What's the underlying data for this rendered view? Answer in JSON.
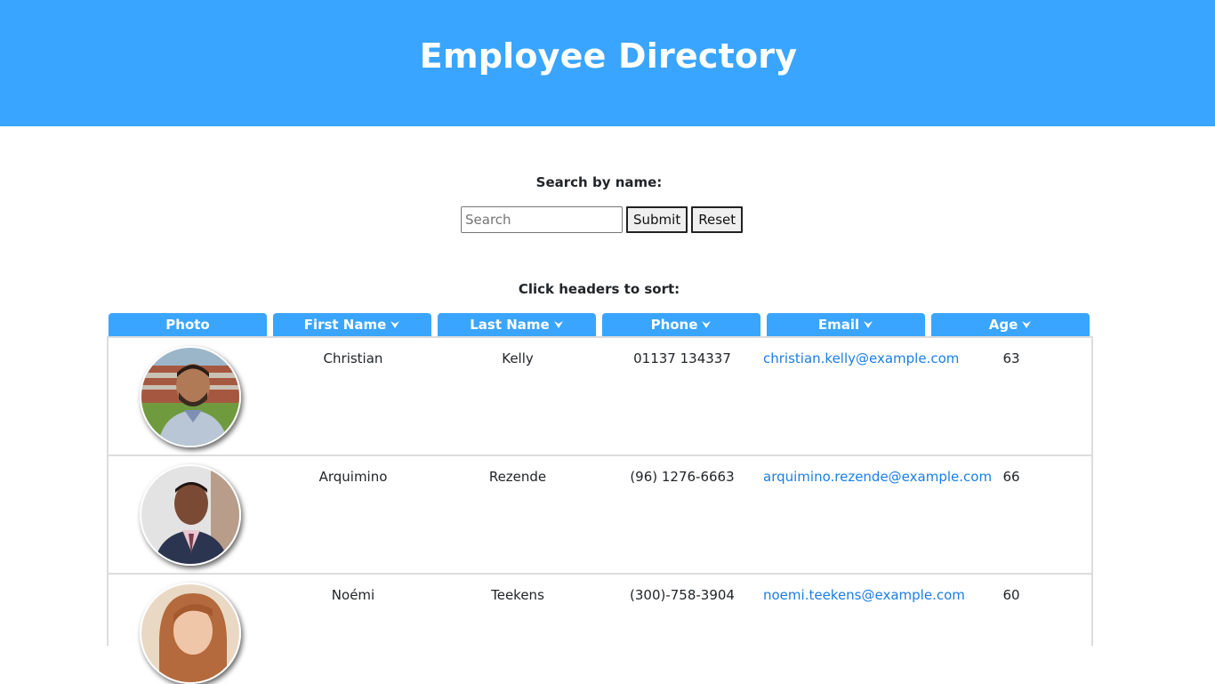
{
  "header": {
    "title": "Employee Directory"
  },
  "search": {
    "label": "Search by name:",
    "placeholder": "Search",
    "value": "",
    "submit_label": "Submit",
    "reset_label": "Reset"
  },
  "sort": {
    "label": "Click headers to sort:"
  },
  "colors": {
    "accent": "#3aa5ff",
    "link": "#1a7ee6",
    "border": "#dcdcdc"
  },
  "columns": [
    {
      "label": "Photo",
      "sortable": false
    },
    {
      "label": "First Name",
      "sortable": true
    },
    {
      "label": "Last Name",
      "sortable": true
    },
    {
      "label": "Phone",
      "sortable": true
    },
    {
      "label": "Email",
      "sortable": true
    },
    {
      "label": "Age",
      "sortable": true
    }
  ],
  "employees": [
    {
      "first": "Christian",
      "last": "Kelly",
      "phone": "01137 134337",
      "email": "christian.kelly@example.com",
      "age": "63"
    },
    {
      "first": "Arquimino",
      "last": "Rezende",
      "phone": "(96) 1276-6663",
      "email": "arquimino.rezende@example.com",
      "age": "66"
    },
    {
      "first": "Noémi",
      "last": "Teekens",
      "phone": "(300)-758-3904",
      "email": "noemi.teekens@example.com",
      "age": "60"
    }
  ]
}
